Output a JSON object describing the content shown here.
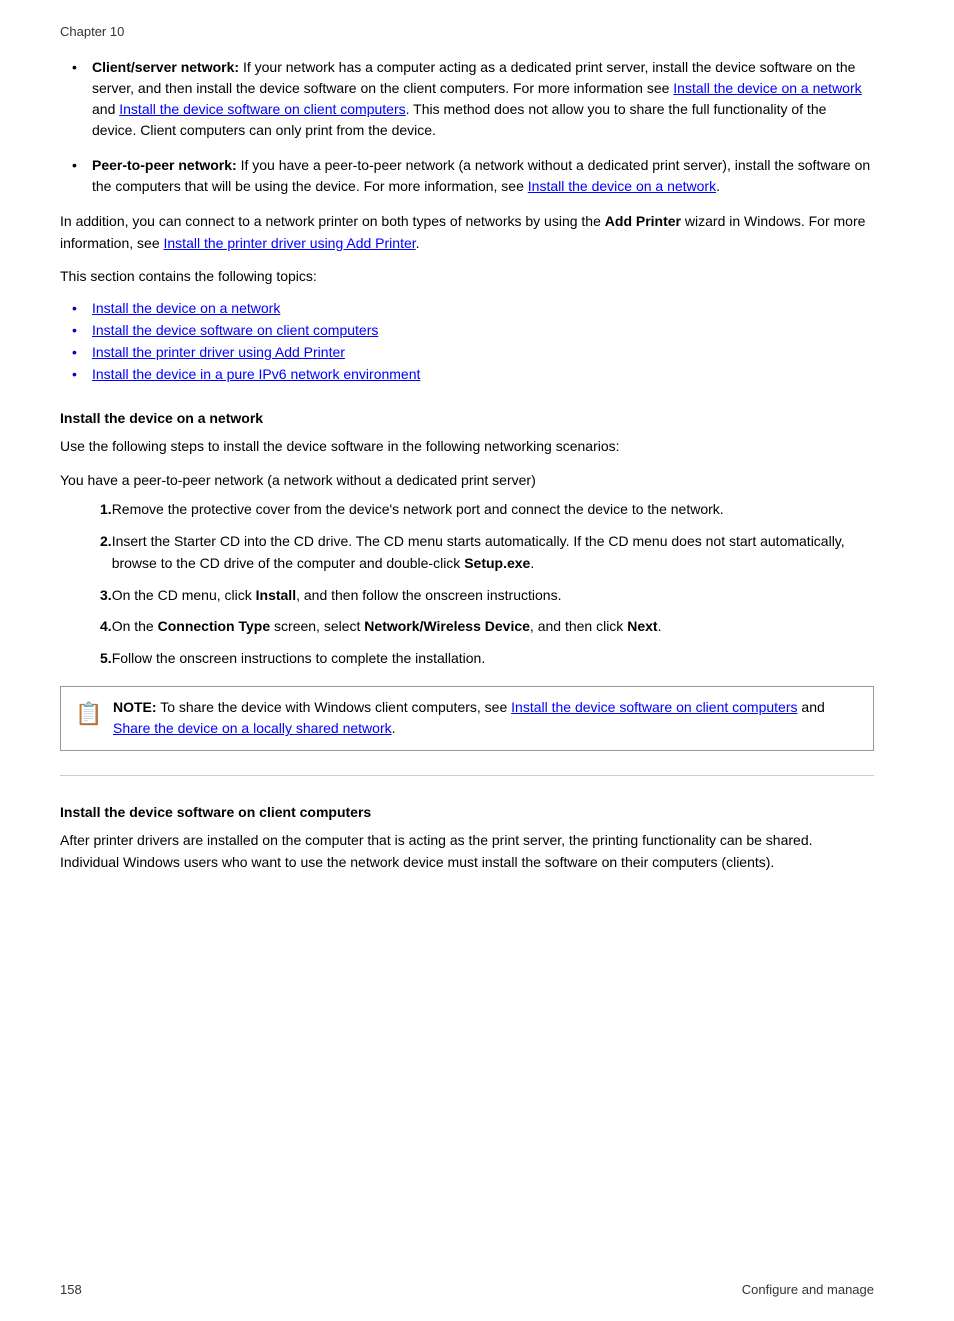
{
  "header": {
    "chapter": "Chapter 10"
  },
  "bullets": [
    {
      "id": "client-server",
      "bold_label": "Client/server network:",
      "text": " If your network has a computer acting as a dedicated print server, install the device software on the server, and then install the device software on the client computers. For more information see ",
      "link1_text": "Install the device on a network",
      "link1_href": "#install-device-network",
      "mid_text": " and ",
      "link2_text": "Install the device software on client computers",
      "link2_href": "#install-device-software-clients",
      "end_text": ". This method does not allow you to share the full functionality of the device. Client computers can only print from the device."
    },
    {
      "id": "peer-to-peer",
      "bold_label": "Peer-to-peer network:",
      "text": " If you have a peer-to-peer network (a network without a dedicated print server), install the software on the computers that will be using the device. For more information, see ",
      "link1_text": "Install the device on a network",
      "link1_href": "#install-device-network",
      "end_text": "."
    }
  ],
  "add_printer_paragraph": "In addition, you can connect to a network printer on both types of networks by using the ",
  "add_printer_bold": "Add Printer",
  "add_printer_mid": " wizard in Windows. For more information, see ",
  "add_printer_link_text": "Install the printer driver using Add Printer",
  "add_printer_link_href": "#install-printer-driver-add-printer",
  "add_printer_end": ".",
  "topics_intro": "This section contains the following topics:",
  "topics": [
    {
      "label": "Install the device on a network",
      "href": "#install-device-network"
    },
    {
      "label": "Install the device software on client computers",
      "href": "#install-device-software-clients"
    },
    {
      "label": "Install the printer driver using Add Printer",
      "href": "#install-printer-driver-add-printer"
    },
    {
      "label": "Install the device in a pure IPv6 network environment",
      "href": "#install-device-ipv6"
    }
  ],
  "section1": {
    "heading": "Install the device on a network",
    "intro": "Use the following steps to install the device software in the following networking scenarios:",
    "peer_note": "You have a peer-to-peer network (a network without a dedicated print server)",
    "steps": [
      {
        "num": "1.",
        "text": "Remove the protective cover from the device's network port and connect the device to the network."
      },
      {
        "num": "2.",
        "text": "Insert the Starter CD into the CD drive. The CD menu starts automatically. If the CD menu does not start automatically, browse to the CD drive of the computer and double-click ",
        "bold": "Setup.exe",
        "end": "."
      },
      {
        "num": "3.",
        "text": "On the CD menu, click ",
        "bold": "Install",
        "end": ", and then follow the onscreen instructions."
      },
      {
        "num": "4.",
        "text": "On the ",
        "bold1": "Connection Type",
        "mid": " screen, select ",
        "bold2": "Network/Wireless Device",
        "end": ", and then click ",
        "bold3": "Next",
        "final": "."
      },
      {
        "num": "5.",
        "text": "Follow the onscreen instructions to complete the installation."
      }
    ],
    "note_label": "NOTE:",
    "note_text": "  To share the device with Windows client computers, see ",
    "note_link1_text": "Install the device software on client computers",
    "note_link1_href": "#install-device-software-clients",
    "note_mid": " and ",
    "note_link2_text": "Share the device on a locally shared network",
    "note_link2_href": "#share-device-locally",
    "note_end": "."
  },
  "section2": {
    "heading": "Install the device software on client computers",
    "text": "After printer drivers are installed on the computer that is acting as the print server, the printing functionality can be shared. Individual Windows users who want to use the network device must install the software on their computers (clients)."
  },
  "footer": {
    "page_number": "158",
    "section_label": "Configure and manage"
  }
}
